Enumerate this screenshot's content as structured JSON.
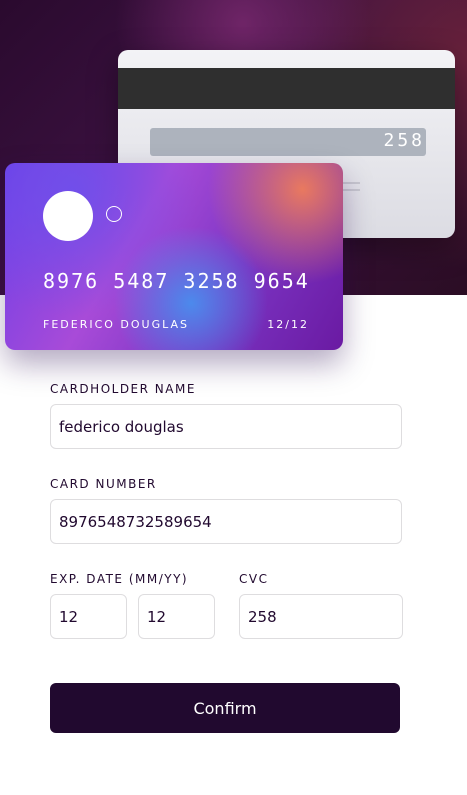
{
  "card_back": {
    "cvc": "258"
  },
  "card_front": {
    "number": "8976 5487 3258 9654",
    "holder": "FEDERICO DOUGLAS",
    "expiry": "12/12"
  },
  "form": {
    "cardholder_label": "CARDHOLDER NAME",
    "cardholder_value": "federico douglas",
    "number_label": "CARD NUMBER",
    "number_value": "8976548732589654",
    "expiry_label": "EXP. DATE (MM/YY)",
    "month_value": "12",
    "year_value": "12",
    "cvc_label": "CVC",
    "cvc_value": "258",
    "confirm_label": "Confirm"
  },
  "colors": {
    "dark_violet": "#21092f",
    "hero_background": "#2a0a2e",
    "input_border": "#dedddf"
  }
}
